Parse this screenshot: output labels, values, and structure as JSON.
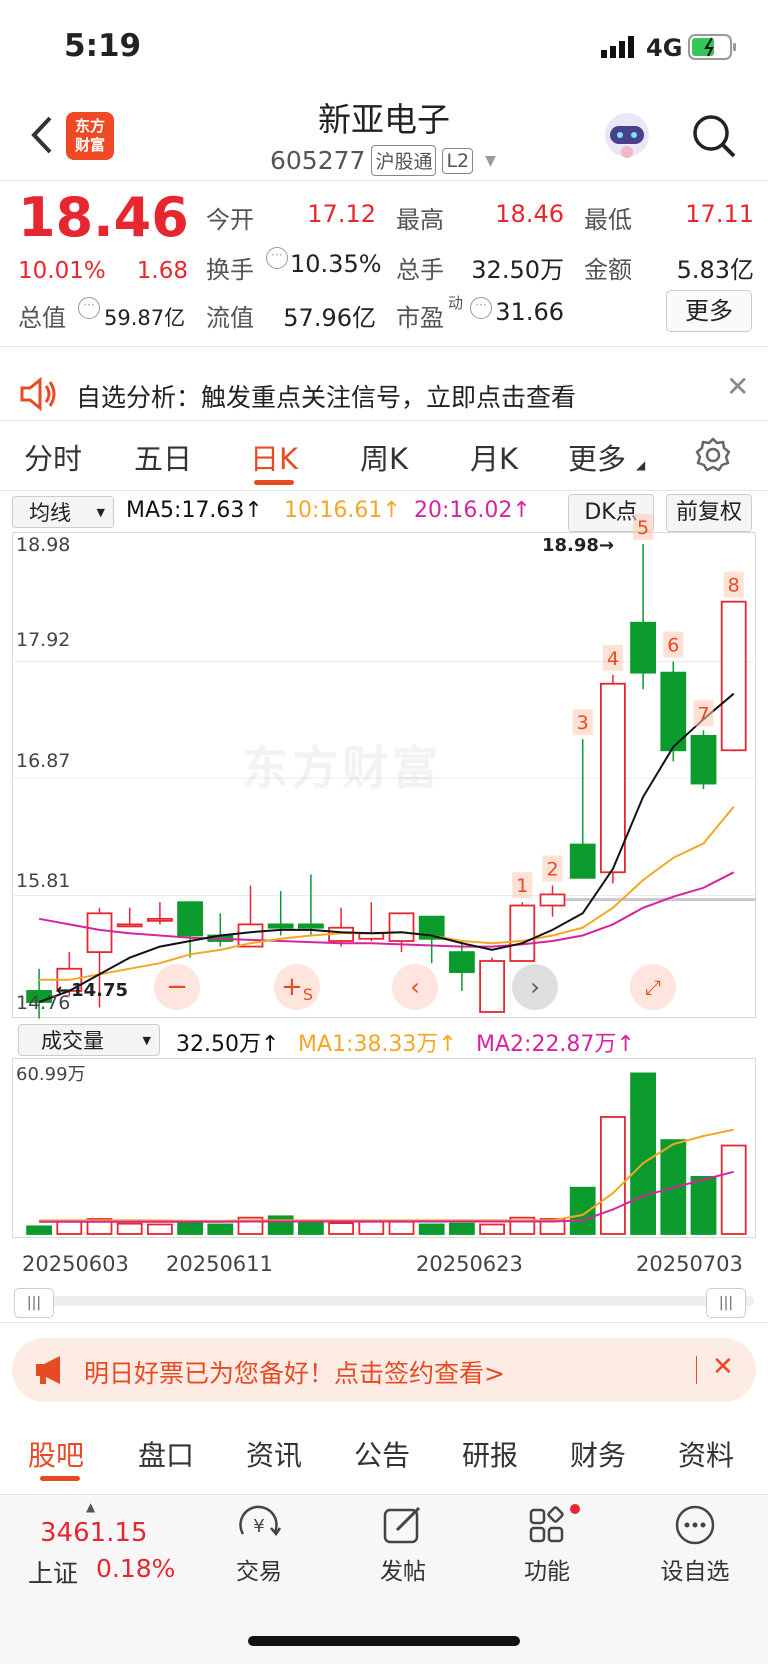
{
  "status_bar": {
    "time": "5:19",
    "network": "4G"
  },
  "header": {
    "title": "新亚电子",
    "code": "605277",
    "badge1": "沪股通",
    "badge2": "L2",
    "logo_text": "东方财富"
  },
  "quote": {
    "price": "18.46",
    "change_pct": "10.01%",
    "change": "1.68",
    "open_label": "今开",
    "open": "17.12",
    "high_label": "最高",
    "high": "18.46",
    "low_label": "最低",
    "low": "17.11",
    "turnover_label": "换手",
    "turnover": "10.35%",
    "volume_label": "总手",
    "volume": "32.50万",
    "amount_label": "金额",
    "amount": "5.83亿",
    "mktcap_label": "总值",
    "mktcap": "59.87亿",
    "float_label": "流值",
    "float": "57.96亿",
    "pe_label": "市盈",
    "pe_sup": "动",
    "pe": "31.66",
    "more": "更多"
  },
  "banner1": {
    "text": "自选分析：触发重点关注信号，立即点击查看"
  },
  "chart_tabs": [
    "分时",
    "五日",
    "日K",
    "周K",
    "月K",
    "更多"
  ],
  "ma_bar": {
    "select": "均线",
    "ma5": "MA5:17.63",
    "ma10": "10:16.61",
    "ma20": "20:16.02",
    "dk": "DK点",
    "fq": "前复权"
  },
  "kchart": {
    "y_labels": [
      "18.98",
      "17.92",
      "16.87",
      "15.81",
      "14.76"
    ],
    "max_label": "18.98→",
    "min_label": "←14.75",
    "watermark": "东方财富"
  },
  "vol_bar": {
    "select": "成交量",
    "vol": "32.50万",
    "ma1": "MA1:38.33万",
    "ma2": "MA2:22.87万",
    "max_label": "60.99万"
  },
  "dates": [
    "20250603",
    "20250611",
    "20250623",
    "20250703"
  ],
  "banner2": {
    "text": "明日好票已为您备好！点击签约查看>"
  },
  "bottom_tabs": [
    "股吧",
    "盘口",
    "资讯",
    "公告",
    "研报",
    "财务",
    "资料"
  ],
  "footer": {
    "index_value": "3461.15",
    "index_name": "上证",
    "index_pct": "0.18%",
    "trade": "交易",
    "post": "发帖",
    "func": "功能",
    "watch": "设自选"
  },
  "colors": {
    "up": "#e8262f",
    "down": "#0a9b2c",
    "accent": "#e84b24",
    "ma5": "#111111",
    "ma10": "#f5a623",
    "ma20": "#d6249f"
  },
  "chart_data": {
    "type": "candlestick",
    "ylim": [
      14.76,
      18.98
    ],
    "dates": [
      "20250603",
      "20250611",
      "20250623",
      "20250703"
    ],
    "candles": [
      {
        "o": 14.95,
        "c": 14.85,
        "h": 15.15,
        "l": 14.7
      },
      {
        "o": 14.95,
        "c": 15.15,
        "h": 15.3,
        "l": 14.9
      },
      {
        "o": 15.3,
        "c": 15.65,
        "h": 15.7,
        "l": 14.8
      },
      {
        "o": 15.55,
        "c": 15.55,
        "h": 15.7,
        "l": 15.55
      },
      {
        "o": 15.6,
        "c": 15.6,
        "h": 15.75,
        "l": 15.55
      },
      {
        "o": 15.75,
        "c": 15.45,
        "h": 15.75,
        "l": 15.25
      },
      {
        "o": 15.45,
        "c": 15.4,
        "h": 15.65,
        "l": 15.35
      },
      {
        "o": 15.35,
        "c": 15.55,
        "h": 15.9,
        "l": 15.35
      },
      {
        "o": 15.55,
        "c": 15.52,
        "h": 15.85,
        "l": 15.45
      },
      {
        "o": 15.55,
        "c": 15.52,
        "h": 16.0,
        "l": 15.45
      },
      {
        "o": 15.4,
        "c": 15.52,
        "h": 15.7,
        "l": 15.35
      },
      {
        "o": 15.42,
        "c": 15.47,
        "h": 15.75,
        "l": 15.4
      },
      {
        "o": 15.4,
        "c": 15.65,
        "h": 15.65,
        "l": 15.3
      },
      {
        "o": 15.62,
        "c": 15.42,
        "h": 15.62,
        "l": 15.2
      },
      {
        "o": 15.3,
        "c": 15.12,
        "h": 15.4,
        "l": 14.95
      },
      {
        "o": 14.76,
        "c": 15.22,
        "h": 15.25,
        "l": 14.76
      },
      {
        "o": 15.22,
        "c": 15.72,
        "h": 15.75,
        "l": 15.22
      },
      {
        "o": 15.72,
        "c": 15.82,
        "h": 15.9,
        "l": 15.62
      },
      {
        "o": 16.27,
        "c": 15.97,
        "h": 17.22,
        "l": 15.97
      },
      {
        "o": 16.02,
        "c": 17.72,
        "h": 17.8,
        "l": 15.92
      },
      {
        "o": 18.27,
        "c": 17.82,
        "h": 18.98,
        "l": 17.67
      },
      {
        "o": 17.82,
        "c": 17.12,
        "h": 17.92,
        "l": 17.02
      },
      {
        "o": 17.25,
        "c": 16.82,
        "h": 17.3,
        "l": 16.77
      },
      {
        "o": 17.12,
        "c": 18.46,
        "h": 18.46,
        "l": 17.11
      }
    ],
    "ma5": [
      14.85,
      14.95,
      15.1,
      15.25,
      15.35,
      15.4,
      15.45,
      15.48,
      15.5,
      15.5,
      15.48,
      15.47,
      15.48,
      15.45,
      15.38,
      15.32,
      15.38,
      15.5,
      15.65,
      16.05,
      16.7,
      17.15,
      17.4,
      17.63
    ],
    "ma10": [
      15.05,
      15.05,
      15.1,
      15.15,
      15.2,
      15.28,
      15.32,
      15.38,
      15.42,
      15.45,
      15.47,
      15.47,
      15.48,
      15.45,
      15.4,
      15.38,
      15.4,
      15.45,
      15.52,
      15.7,
      15.95,
      16.15,
      16.28,
      16.61
    ],
    "ma20": [
      15.6,
      15.55,
      15.5,
      15.47,
      15.45,
      15.43,
      15.42,
      15.41,
      15.4,
      15.39,
      15.38,
      15.38,
      15.37,
      15.36,
      15.35,
      15.35,
      15.37,
      15.4,
      15.45,
      15.55,
      15.7,
      15.8,
      15.88,
      16.02
    ],
    "volume_max": 60.99,
    "volume": [
      2.8,
      5.0,
      5.5,
      3.8,
      3.5,
      4.0,
      3.5,
      6.0,
      6.5,
      4.5,
      4.0,
      4.5,
      4.5,
      3.5,
      3.8,
      3.5,
      6.0,
      5.5,
      17.0,
      43.0,
      59.0,
      34.5,
      21.0,
      32.5
    ],
    "vol_ma1": [
      5.0,
      5.0,
      5.0,
      5.0,
      5.0,
      4.8,
      4.8,
      5.0,
      5.0,
      5.0,
      5.0,
      5.0,
      5.0,
      5.0,
      5.0,
      5.0,
      5.0,
      5.0,
      7.0,
      15.0,
      26.0,
      33.0,
      36.0,
      38.33
    ],
    "vol_ma2": [
      4.5,
      4.5,
      4.5,
      4.5,
      4.5,
      4.5,
      4.5,
      4.6,
      4.6,
      4.6,
      4.6,
      4.6,
      4.6,
      4.6,
      4.6,
      4.6,
      4.6,
      4.6,
      5.0,
      9.0,
      14.0,
      17.0,
      20.0,
      22.87
    ]
  }
}
